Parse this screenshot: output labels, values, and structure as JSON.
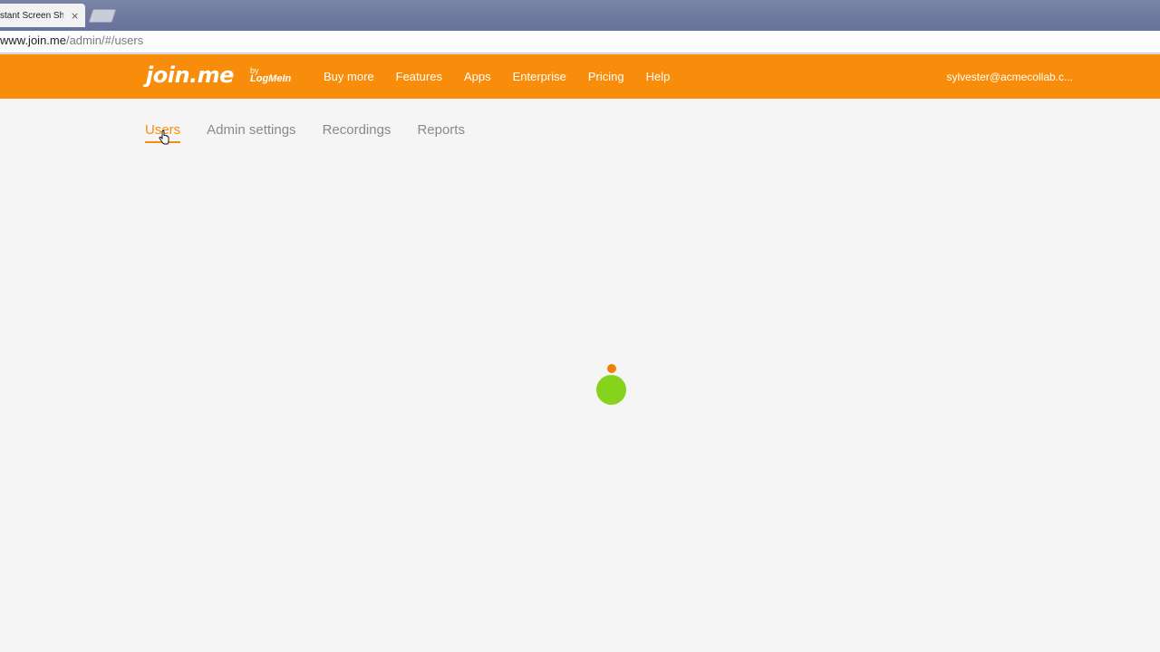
{
  "browser": {
    "tab_title": "stant Screen Sh",
    "tab_close": "×",
    "url_host": "www.join.me",
    "url_path": "/admin/#/users"
  },
  "header": {
    "logo": "join.me",
    "logo_by": "by",
    "logo_brand": "LogMeIn",
    "nav": [
      "Buy more",
      "Features",
      "Apps",
      "Enterprise",
      "Pricing",
      "Help"
    ],
    "user_email": "sylvester@acmecollab.c..."
  },
  "subtabs": {
    "items": [
      "Users",
      "Admin settings",
      "Recordings",
      "Reports"
    ],
    "active": "Users"
  },
  "colors": {
    "brand_orange": "#f78d0a",
    "spinner_green": "#86d21c",
    "spinner_orange": "#f07f0a"
  },
  "icons": {
    "cursor": "hand-pointer-icon",
    "spinner": "loading-spinner-icon"
  }
}
